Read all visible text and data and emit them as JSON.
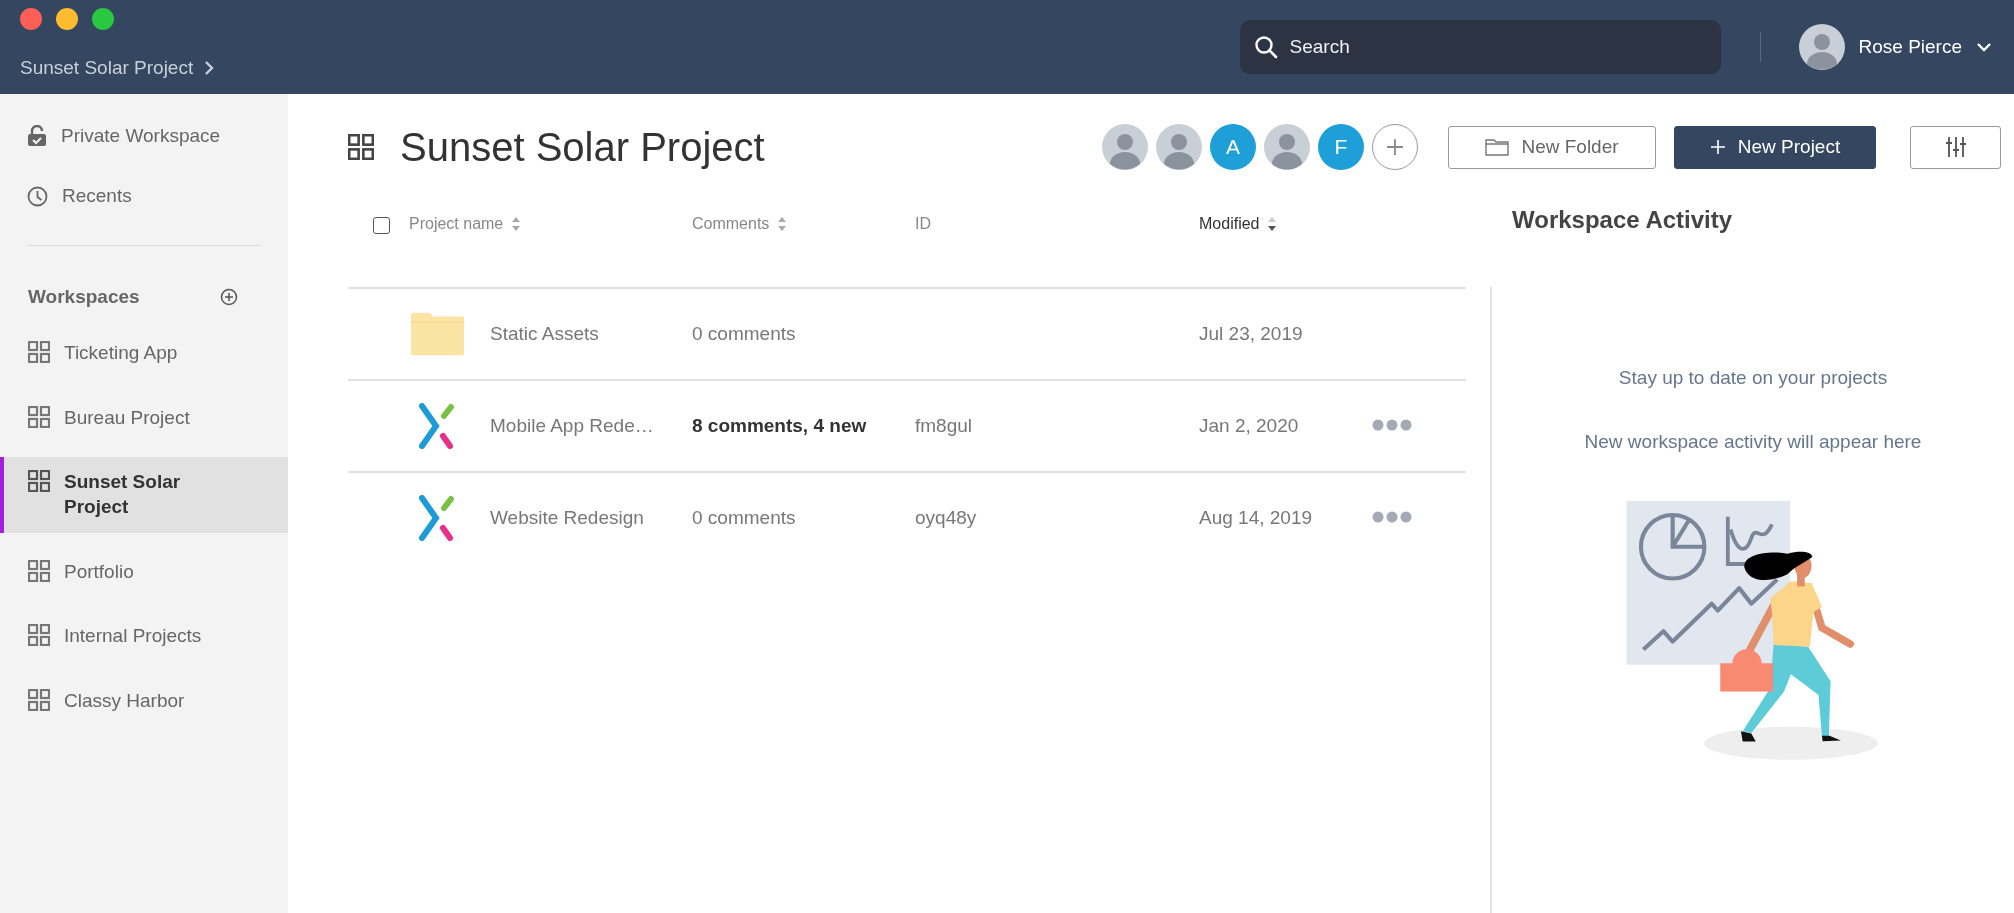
{
  "window": {
    "breadcrumb": "Sunset Solar Project"
  },
  "search": {
    "placeholder": "Search"
  },
  "user": {
    "name": "Rose Pierce"
  },
  "sidebar": {
    "items": [
      {
        "label": "Private Workspace",
        "kind": "lock"
      },
      {
        "label": "Recents",
        "kind": "clock"
      }
    ],
    "workspaces_heading": "Workspaces",
    "workspaces": [
      {
        "label": "Ticketing App",
        "selected": false
      },
      {
        "label": "Bureau Project",
        "selected": false
      },
      {
        "label": "Sunset Solar Project",
        "selected": true
      },
      {
        "label": "Portfolio",
        "selected": false
      },
      {
        "label": "Internal Projects",
        "selected": false
      },
      {
        "label": "Classy Harbor",
        "selected": false
      }
    ]
  },
  "header": {
    "title": "Sunset Solar Project",
    "members": [
      {
        "kind": "photo"
      },
      {
        "kind": "photo"
      },
      {
        "kind": "initial",
        "initial": "A"
      },
      {
        "kind": "photo"
      },
      {
        "kind": "initial",
        "initial": "F"
      },
      {
        "kind": "add"
      }
    ],
    "buttons": [
      {
        "label": "New Folder",
        "kind": "secondary"
      },
      {
        "label": "New Project",
        "kind": "primary"
      }
    ]
  },
  "table": {
    "select_all": {
      "checked": false
    },
    "columns": [
      {
        "label": "Project name",
        "sortable": true,
        "sorted": false
      },
      {
        "label": "Comments",
        "sortable": true,
        "sorted": false
      },
      {
        "label": "ID",
        "sortable": false,
        "sorted": false
      },
      {
        "label": "Modified",
        "sortable": true,
        "sorted": true
      }
    ],
    "rows": [
      {
        "kind": "folder",
        "name": "Static Assets",
        "comments": "0 comments",
        "unread": false,
        "modified": "Jul 23, 2019",
        "has_menu": false
      },
      {
        "kind": "project",
        "name": "Mobile App Rede…",
        "comments": "8 comments, 4 new",
        "unread": true,
        "id": "fm8gul",
        "modified": "Jan 2, 2020",
        "has_menu": true
      },
      {
        "kind": "project",
        "name": "Website Redesign",
        "comments": "0 comments",
        "unread": false,
        "id": "oyq48y",
        "modified": "Aug 14, 2019",
        "has_menu": true
      }
    ]
  },
  "activity": {
    "title": "Workspace Activity",
    "messages": [
      "Stay up to date on your projects",
      "New workspace activity will appear here"
    ]
  }
}
